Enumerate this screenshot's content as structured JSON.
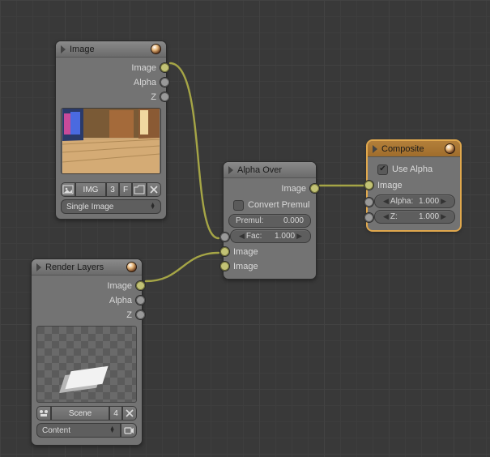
{
  "image_node": {
    "title": "Image",
    "outputs": {
      "image": "Image",
      "alpha": "Alpha",
      "z": "Z"
    },
    "buttons": {
      "img_label": "IMG",
      "users": "3",
      "fake": "F"
    },
    "dropdown": "Single Image"
  },
  "render_node": {
    "title": "Render Layers",
    "outputs": {
      "image": "Image",
      "alpha": "Alpha",
      "z": "Z"
    },
    "scene_label": "Scene",
    "users": "4",
    "layer_label": "Content"
  },
  "alpha_node": {
    "title": "Alpha Over",
    "outputs": {
      "image": "Image"
    },
    "convert_label": "Convert Premul",
    "premul_label": "Premul:",
    "premul_value": "0.000",
    "fac_label": "Fac:",
    "fac_value": "1.000",
    "inputs": {
      "image1": "Image",
      "image2": "Image"
    }
  },
  "composite_node": {
    "title": "Composite",
    "use_alpha_label": "Use Alpha",
    "inputs": {
      "image": "Image",
      "alpha_label": "Alpha:",
      "alpha_value": "1.000",
      "z_label": "Z:",
      "z_value": "1.000"
    }
  }
}
